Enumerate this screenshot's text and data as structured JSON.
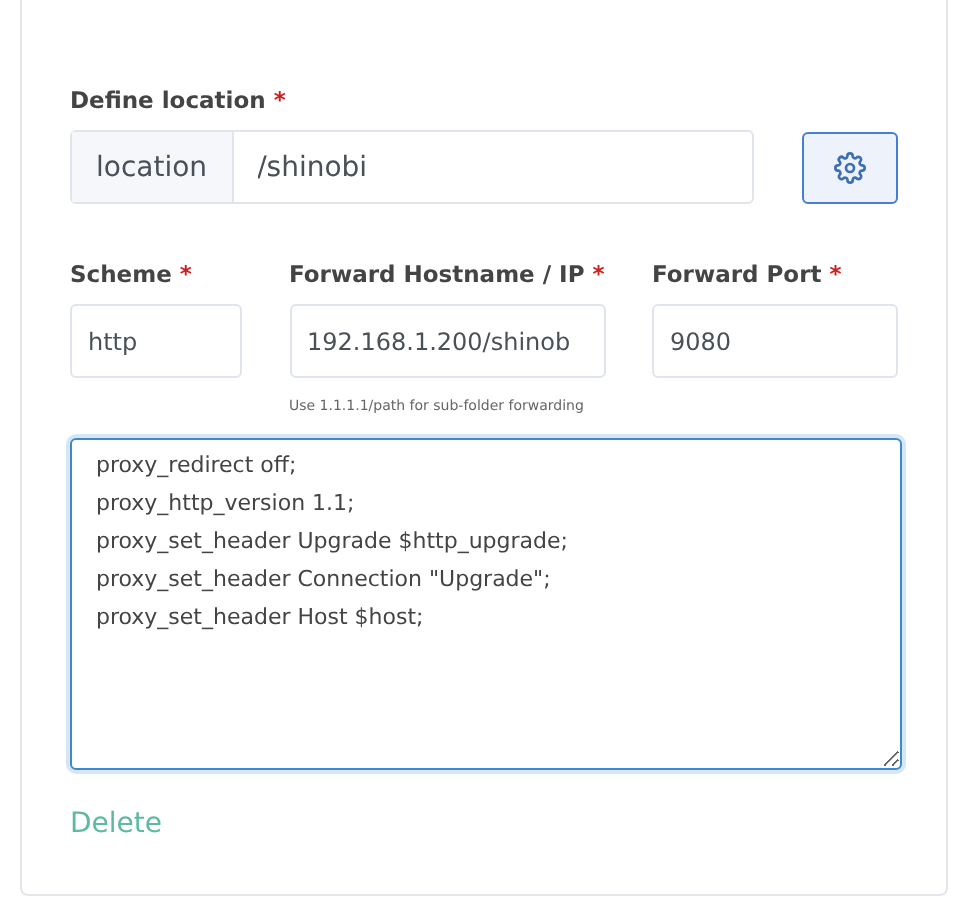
{
  "location": {
    "label": "Define location",
    "required": "*",
    "prefix": "location",
    "value": "/shinobi"
  },
  "fields": [
    {
      "label": "Scheme",
      "required": "*",
      "value": "http"
    },
    {
      "label": "Forward Hostname / IP",
      "required": "*",
      "value": "192.168.1.200/shinob",
      "hint": "Use 1.1.1.1/path for sub-folder forwarding"
    },
    {
      "label": "Forward Port",
      "required": "*",
      "value": "9080"
    }
  ],
  "advanced_config": {
    "lines": [
      "proxy_redirect off;",
      "proxy_http_version 1.1;",
      "proxy_set_header Upgrade $http_upgrade;",
      "proxy_set_header Connection \"Upgrade\";",
      "proxy_set_header Host $host;"
    ],
    "focused": true
  },
  "delete_link": "Delete"
}
